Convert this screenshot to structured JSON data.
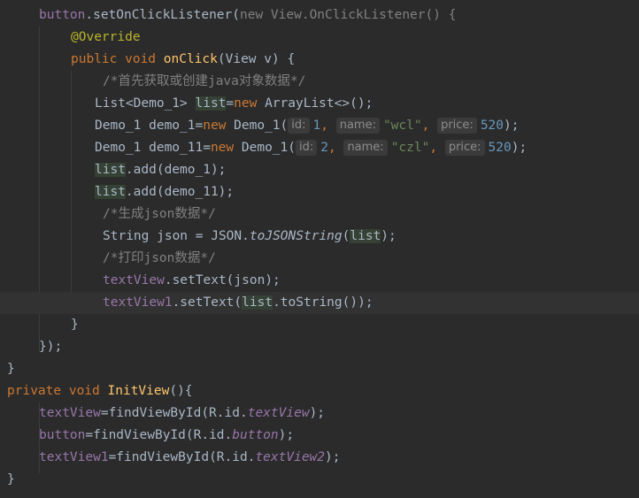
{
  "colors": {
    "background": "#2b2b2b",
    "keyword": "#cc7832",
    "annotation": "#bbb529",
    "method_declaration": "#ffc66d",
    "number": "#6897bb",
    "string": "#6a8759",
    "comment": "#808080",
    "field": "#9876aa",
    "identifier_highlight": "#344134",
    "caret_line": "#323232",
    "plain_text": "#a9b7c6"
  },
  "code": {
    "l1": {
      "a": "button",
      "b": ".setOnClickListener(",
      "c": "new View.OnClickListener() {"
    },
    "l2": {
      "a": "@Override"
    },
    "l3": {
      "a": "public void ",
      "b": "onClick",
      "c": "(View v) {"
    },
    "l4": {
      "a": "/*首先获取或创建java对象数据*/"
    },
    "l5": {
      "a": "List<Demo_1> ",
      "b": "list",
      "c": "=",
      "d": "new ",
      "e": "ArrayList<>();"
    },
    "l6": {
      "a": "Demo_1 demo_1=",
      "b": "new ",
      "c": "Demo_1(",
      "d": "id:",
      "e": "1",
      "f": ", ",
      "g": "name:",
      "h": "\"wcl\"",
      "i": ", ",
      "j": "price:",
      "k": "520",
      "l": ");"
    },
    "l7": {
      "a": "Demo_1 demo_11=",
      "b": "new ",
      "c": "Demo_1(",
      "d": "id:",
      "e": "2",
      "f": ", ",
      "g": "name:",
      "h": "\"czl\"",
      "i": ", ",
      "j": "price:",
      "k": "520",
      "l": ");"
    },
    "l8": {
      "a": "list",
      "b": ".add(demo_1);"
    },
    "l9": {
      "a": "list",
      "b": ".add(demo_11);"
    },
    "l10": {
      "a": "/*生成json数据*/"
    },
    "l11": {
      "a": "String json = JSON.",
      "b": "toJSONString",
      "c": "(",
      "d": "list",
      "e": ");"
    },
    "l12": {
      "a": "/*打印json数据*/"
    },
    "l13": {
      "a": "textView",
      "b": ".setText(json);"
    },
    "l14": {
      "a": "textView1",
      "b": ".setText(",
      "c": "list",
      "d": ".toString());"
    },
    "l15": {
      "a": "}"
    },
    "l16": {
      "a": "});"
    },
    "l17": {
      "a": "}"
    },
    "l18": {
      "a": "private void ",
      "b": "InitView",
      "c": "(){"
    },
    "l19": {
      "a": "textView",
      "b": "=findViewById(R.id.",
      "c": "textView",
      "d": ");"
    },
    "l20": {
      "a": "button",
      "b": "=findViewById(R.id.",
      "c": "button",
      "d": ");"
    },
    "l21": {
      "a": "textView1",
      "b": "=findViewById(R.id.",
      "c": "textView2",
      "d": ");"
    },
    "l22": {
      "a": "}"
    }
  }
}
